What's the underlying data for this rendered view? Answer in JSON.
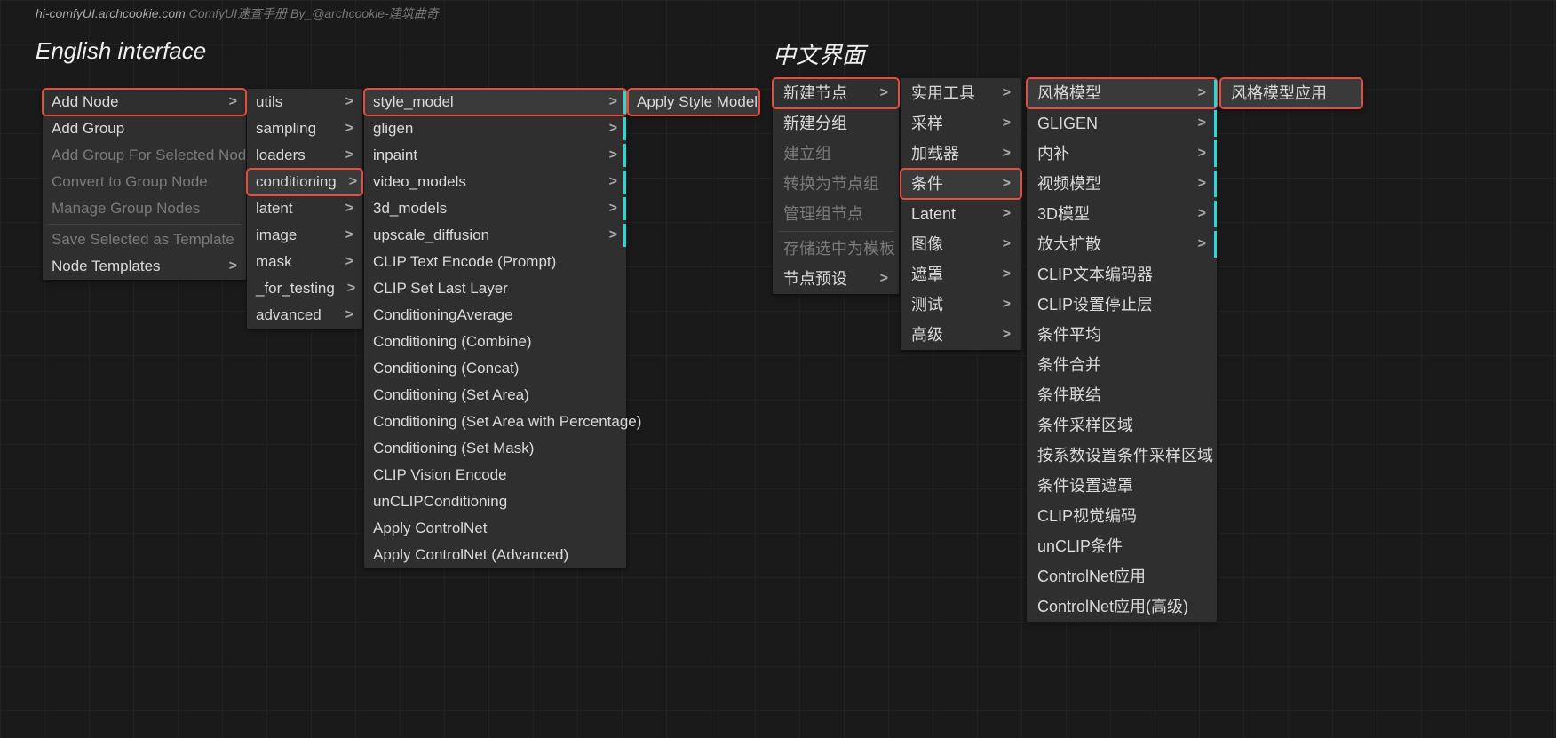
{
  "header": {
    "url": "hi-comfyUI.archcookie.com",
    "desc": "ComfyUI速查手册 By_@archcookie-建筑曲奇"
  },
  "titles": {
    "en": "English interface",
    "zh": "中文界面"
  },
  "en": {
    "col1": [
      {
        "label": "Add Node",
        "sub": true,
        "red": true
      },
      {
        "label": "Add Group"
      },
      {
        "label": "Add Group For Selected Nodes",
        "dim": true
      },
      {
        "label": "Convert to Group Node",
        "dim": true
      },
      {
        "label": "Manage Group Nodes",
        "dim": true
      },
      {
        "divider": true
      },
      {
        "label": "Save Selected as Template",
        "dim": true
      },
      {
        "label": "Node Templates",
        "sub": true
      }
    ],
    "col2": [
      {
        "label": "utils",
        "sub": true
      },
      {
        "label": "sampling",
        "sub": true
      },
      {
        "label": "loaders",
        "sub": true
      },
      {
        "label": "conditioning",
        "sub": true,
        "red": true,
        "hl": true
      },
      {
        "label": "latent",
        "sub": true
      },
      {
        "label": "image",
        "sub": true
      },
      {
        "label": "mask",
        "sub": true
      },
      {
        "label": "_for_testing",
        "sub": true
      },
      {
        "label": "advanced",
        "sub": true
      }
    ],
    "col3": [
      {
        "label": "style_model",
        "sub": true,
        "red": true,
        "hl": true,
        "cyan": true
      },
      {
        "label": "gligen",
        "sub": true,
        "cyan": true
      },
      {
        "label": "inpaint",
        "sub": true,
        "cyan": true
      },
      {
        "label": "video_models",
        "sub": true,
        "cyan": true
      },
      {
        "label": "3d_models",
        "sub": true,
        "cyan": true
      },
      {
        "label": "upscale_diffusion",
        "sub": true,
        "cyan": true
      },
      {
        "label": "CLIP Text Encode (Prompt)"
      },
      {
        "label": "CLIP Set Last Layer"
      },
      {
        "label": "ConditioningAverage"
      },
      {
        "label": "Conditioning (Combine)"
      },
      {
        "label": "Conditioning (Concat)"
      },
      {
        "label": "Conditioning (Set Area)"
      },
      {
        "label": "Conditioning (Set Area with Percentage)"
      },
      {
        "label": "Conditioning (Set Mask)"
      },
      {
        "label": "CLIP Vision Encode"
      },
      {
        "label": "unCLIPConditioning"
      },
      {
        "label": "Apply ControlNet"
      },
      {
        "label": "Apply ControlNet (Advanced)"
      }
    ],
    "col4": [
      {
        "label": "Apply Style Model",
        "red": true,
        "hl": true
      }
    ]
  },
  "zh": {
    "col1": [
      {
        "label": "新建节点",
        "sub": true,
        "red": true
      },
      {
        "label": "新建分组"
      },
      {
        "label": "建立组",
        "dim": true
      },
      {
        "label": "转换为节点组",
        "dim": true
      },
      {
        "label": "管理组节点",
        "dim": true
      },
      {
        "divider": true
      },
      {
        "label": "存储选中为模板",
        "dim": true
      },
      {
        "label": "节点预设",
        "sub": true
      }
    ],
    "col2": [
      {
        "label": "实用工具",
        "sub": true
      },
      {
        "label": "采样",
        "sub": true
      },
      {
        "label": "加载器",
        "sub": true
      },
      {
        "label": "条件",
        "sub": true,
        "red": true,
        "hl": true
      },
      {
        "label": "Latent",
        "sub": true
      },
      {
        "label": "图像",
        "sub": true
      },
      {
        "label": "遮罩",
        "sub": true
      },
      {
        "label": "测试",
        "sub": true
      },
      {
        "label": "高级",
        "sub": true
      }
    ],
    "col3": [
      {
        "label": "风格模型",
        "sub": true,
        "red": true,
        "hl": true,
        "cyan": true
      },
      {
        "label": "GLIGEN",
        "sub": true,
        "cyan": true
      },
      {
        "label": "内补",
        "sub": true,
        "cyan": true
      },
      {
        "label": "视频模型",
        "sub": true,
        "cyan": true
      },
      {
        "label": "3D模型",
        "sub": true,
        "cyan": true
      },
      {
        "label": "放大扩散",
        "sub": true,
        "cyan": true
      },
      {
        "label": "CLIP文本编码器"
      },
      {
        "label": "CLIP设置停止层"
      },
      {
        "label": "条件平均"
      },
      {
        "label": "条件合并"
      },
      {
        "label": "条件联结"
      },
      {
        "label": "条件采样区域"
      },
      {
        "label": "按系数设置条件采样区域"
      },
      {
        "label": "条件设置遮罩"
      },
      {
        "label": "CLIP视觉编码"
      },
      {
        "label": "unCLIP条件"
      },
      {
        "label": "ControlNet应用"
      },
      {
        "label": "ControlNet应用(高级)"
      }
    ],
    "col4": [
      {
        "label": "风格模型应用",
        "red": true,
        "hl": true
      }
    ]
  }
}
